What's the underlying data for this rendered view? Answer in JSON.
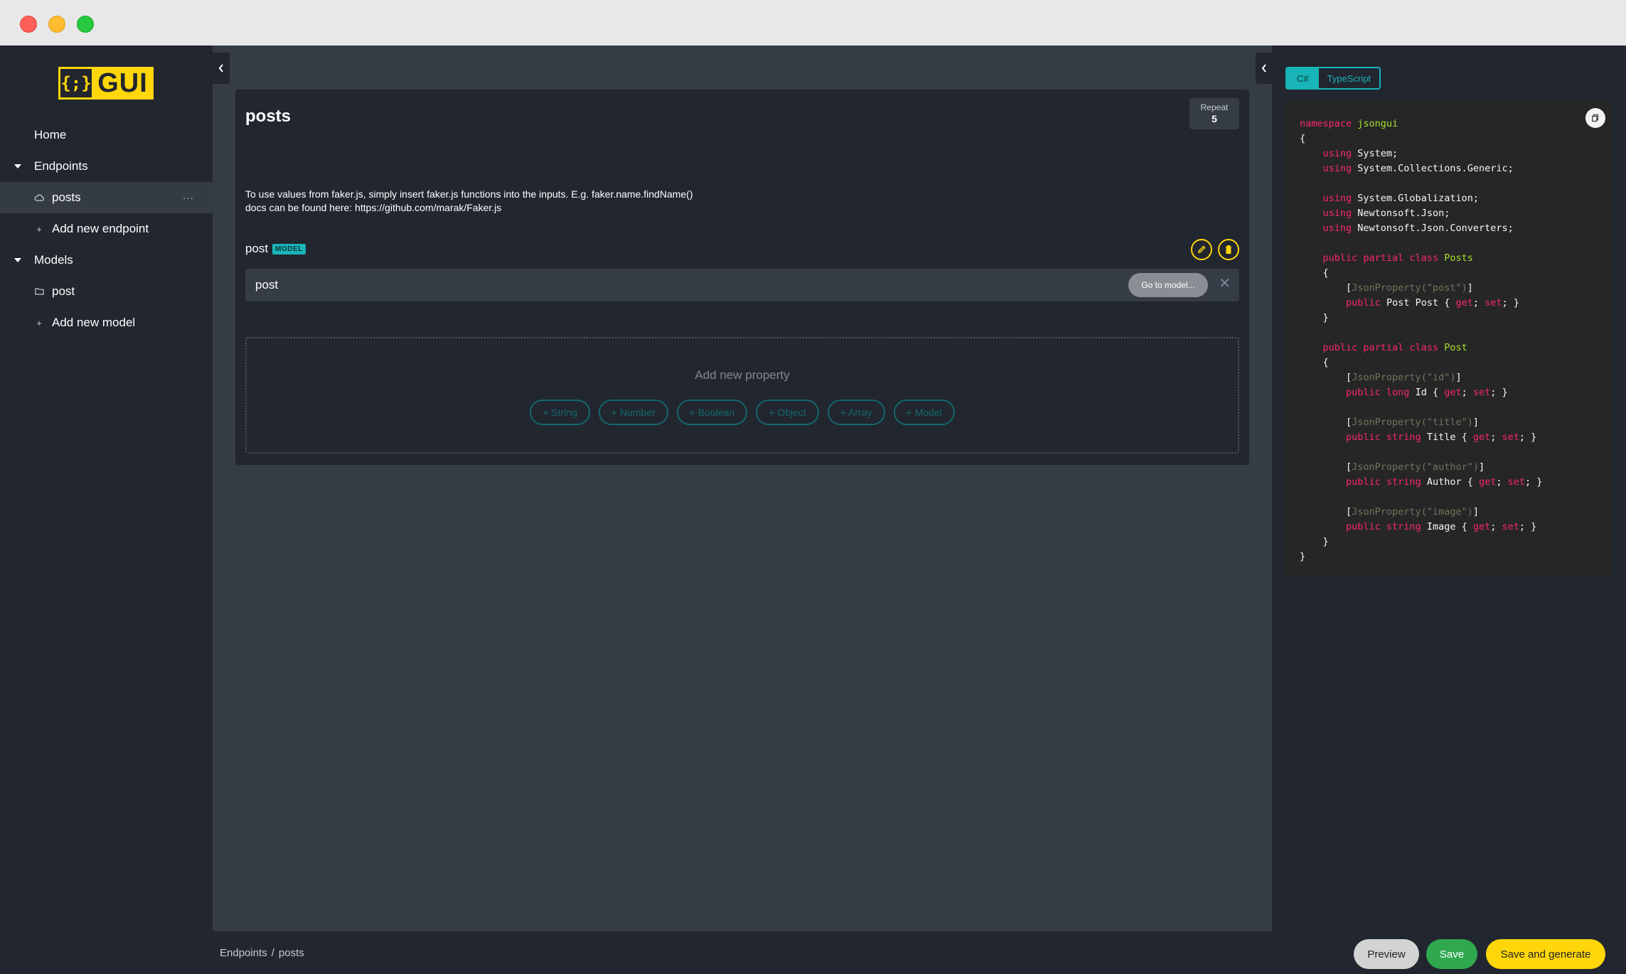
{
  "window": {
    "controls": [
      "close",
      "minimize",
      "maximize"
    ]
  },
  "logo": {
    "braces": "{;}",
    "word": "GUI"
  },
  "sidebar": {
    "home": "Home",
    "endpoints_label": "Endpoints",
    "endpoint_items": [
      {
        "label": "posts",
        "more": "···"
      }
    ],
    "add_endpoint": "Add new endpoint",
    "models_label": "Models",
    "model_items": [
      {
        "label": "post"
      }
    ],
    "add_model": "Add new model"
  },
  "main": {
    "title": "posts",
    "repeat_label": "Repeat",
    "repeat_value": "5",
    "hint_line1": "To use values from faker.js, simply insert faker.js functions into the inputs. E.g. faker.name.findName()",
    "hint_line2": "docs can be found here: https://github.com/marak/Faker.js",
    "model_name": "post",
    "model_badge": "MODEL",
    "model_field_value": "post",
    "goto_model": "Go to model...",
    "add_property_title": "Add new property",
    "property_types": [
      "+ String",
      "+ Number",
      "+ Boolean",
      "+ Object",
      "+ Array",
      "+ Model"
    ]
  },
  "breadcrumb": {
    "items": [
      "Endpoints",
      "posts"
    ],
    "separator": "/"
  },
  "right_panel": {
    "tabs": [
      {
        "label": "C#",
        "selected": true
      },
      {
        "label": "TypeScript",
        "selected": false
      }
    ]
  },
  "footer": {
    "preview": "Preview",
    "save": "Save",
    "save_generate": "Save and generate"
  },
  "colors": {
    "accent_yellow": "#ffd60a",
    "accent_teal": "#19b4b8",
    "save_green": "#2fa84f",
    "sidebar_bg": "#21262f",
    "main_bg": "#363c46"
  }
}
